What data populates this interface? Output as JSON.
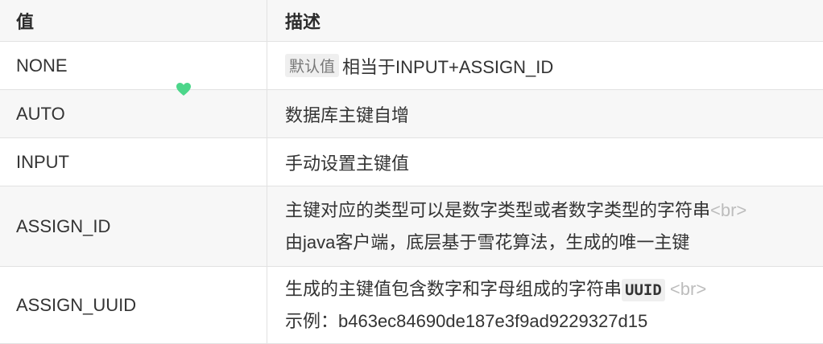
{
  "header": {
    "col1": "值",
    "col2": "描述"
  },
  "rows": [
    {
      "value": "NONE",
      "tag": "默认值",
      "desc": "相当于INPUT+ASSIGN_ID"
    },
    {
      "value": "AUTO",
      "desc": "数据库主键自增"
    },
    {
      "value": "INPUT",
      "desc": "手动设置主键值"
    },
    {
      "value": "ASSIGN_ID",
      "line1": "主键对应的类型可以是数字类型或者数字类型的字符串",
      "br": "<br>",
      "line2": "由java客户端，底层基于雪花算法，生成的唯一主键"
    },
    {
      "value": "ASSIGN_UUID",
      "line1": "生成的主键值包含数字和字母组成的字符串",
      "code": "UUID",
      "br": "<br>",
      "line2": "示例：b463ec84690de187e3f9ad9229327d15"
    }
  ],
  "colors": {
    "heart": "#4cd68a",
    "alt_row": "#f7f7f7",
    "border": "#e2e2e2"
  }
}
